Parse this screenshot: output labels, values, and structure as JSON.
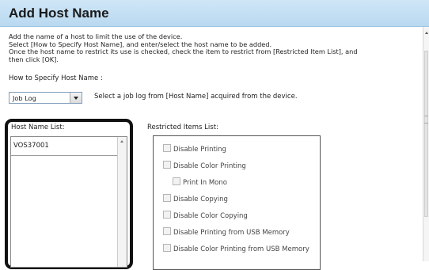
{
  "dialog": {
    "title": "Add Host Name",
    "description": [
      "Add the name of a host to limit the use of the device.",
      "Select [How to Specify Host Name], and enter/select the host name to be added.",
      "Once the host name to restrict its use is checked, check the item to restrict from [Restricted Item List], and",
      "then click [OK]."
    ],
    "how_to_label": "How to Specify Host Name :",
    "how_to_select": {
      "value": "Job Log"
    },
    "how_to_hint": "Select a job log from [Host Name] acquired from the device.",
    "host_list": {
      "label": "Host Name List:",
      "items": [
        "VOS37001"
      ]
    },
    "restricted": {
      "label": "Restricted Items List:",
      "items": [
        "Disable Printing",
        "Disable Color Printing",
        "Print In Mono",
        "Disable Copying",
        "Disable Color Copying",
        "Disable Printing from USB Memory",
        "Disable Color Printing from USB Memory"
      ]
    }
  }
}
